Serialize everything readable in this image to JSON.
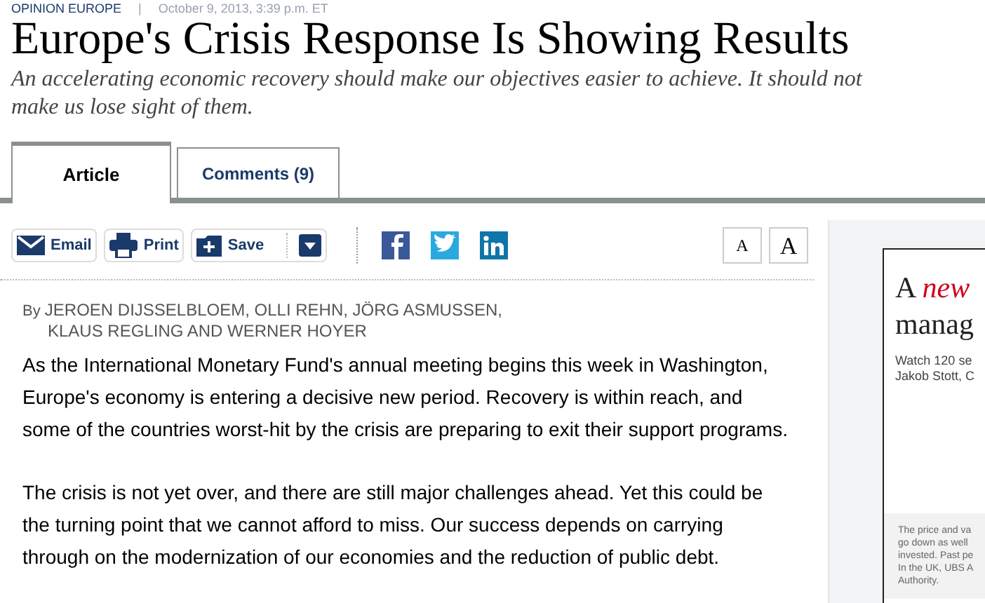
{
  "kicker": {
    "section": "OPINION EUROPE",
    "separator": "|",
    "date": "October 9, 2013, 3:39 p.m. ET"
  },
  "headline": "Europe's Crisis Response Is Showing Results",
  "dek": "An accelerating economic recovery should make our objectives easier to achieve. It should not make us lose sight of them.",
  "tabs": [
    {
      "label": "Article",
      "selected": true
    },
    {
      "label": "Comments (9)",
      "selected": false
    }
  ],
  "tools": [
    {
      "kind": "email",
      "label": "Email"
    },
    {
      "kind": "print",
      "label": "Print"
    },
    {
      "kind": "save",
      "label": "Save"
    }
  ],
  "social": [
    {
      "kind": "facebook"
    },
    {
      "kind": "twitter"
    },
    {
      "kind": "linkedin"
    }
  ],
  "font_sizes": [
    {
      "label": "A",
      "kind": "small"
    },
    {
      "label": "A",
      "kind": "large"
    }
  ],
  "byline": {
    "prefix": "By",
    "authors": [
      "JEROEN DIJSSELBLOEM, OLLI REHN, JÖRG ASMUSSEN,",
      "KLAUS REGLING AND WERNER HOYER"
    ]
  },
  "paragraphs": [
    "As the International Monetary Fund's annual meeting begins this week in Washington, Europe's economy is entering a decisive new period. Recovery is within reach, and some of the countries worst-hit by the crisis are preparing to exit their support programs.",
    "The crisis is not yet over, and there are still major challenges ahead. Yet this could be the turning point that we cannot afford to miss. Our success depends on carrying through on the modernization of our economies and the reduction of public debt."
  ],
  "ad": {
    "headline_start": "A",
    "headline_accent": "new",
    "headline_line2": "manag",
    "body": [
      "Watch 120 se",
      "Jakob Stott, C"
    ],
    "disclaimer": [
      "The price and va",
      "go down as well",
      "invested. Past pe",
      "In the UK, UBS A",
      "Authority."
    ]
  }
}
